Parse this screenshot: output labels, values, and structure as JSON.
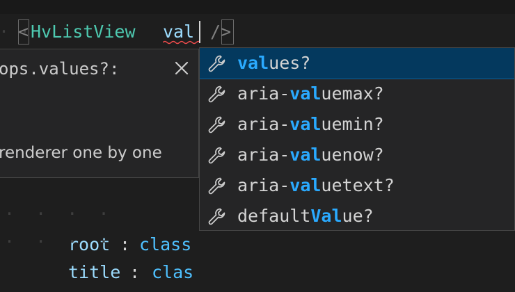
{
  "editor": {
    "line_open": "<",
    "tag": "HvListView",
    "attr_typed": "val",
    "line_close": "/>",
    "indent_guides": "· ·",
    "below_lines": [
      {
        "prop": "root",
        "colon": ":",
        "value": "class"
      },
      {
        "prop": "title",
        "colon": ":",
        "value": "clas"
      }
    ]
  },
  "detail": {
    "signature": "ops.values?:",
    "close_label": "×",
    "doc_text": "renderer one by one"
  },
  "suggestions": {
    "selected_index": 0,
    "icon": "wrench-icon",
    "items": [
      {
        "before": "",
        "match": "val",
        "after": "ues?"
      },
      {
        "before": "aria-",
        "match": "val",
        "after": "uemax?"
      },
      {
        "before": "aria-",
        "match": "val",
        "after": "uemin?"
      },
      {
        "before": "aria-",
        "match": "val",
        "after": "uenow?"
      },
      {
        "before": "aria-",
        "match": "val",
        "after": "uetext?"
      },
      {
        "before": "default",
        "match": "Val",
        "after": "ue?"
      }
    ]
  },
  "colors": {
    "background": "#1e1e1e",
    "tag": "#4ec9b0",
    "attribute": "#9cdcfe",
    "match_highlight": "#2aaaff",
    "selection": "#04395e"
  }
}
